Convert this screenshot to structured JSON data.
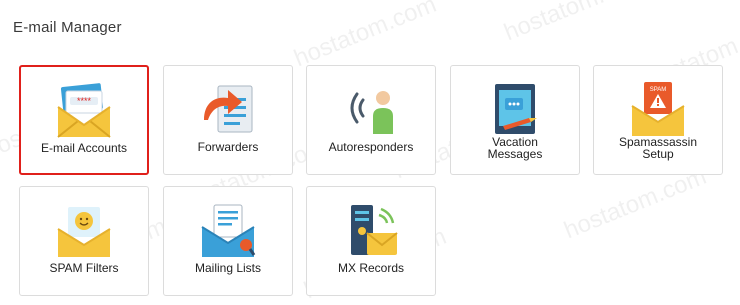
{
  "page": {
    "title": "E-mail Manager"
  },
  "tiles": [
    {
      "label": "E-mail Accounts",
      "icon": "envelope-password-icon"
    },
    {
      "label": "Forwarders",
      "icon": "forward-arrow-document-icon"
    },
    {
      "label": "Autoresponders",
      "icon": "person-broadcast-icon"
    },
    {
      "label_line1": "Vacation",
      "label_line2": "Messages",
      "icon": "vacation-message-icon"
    },
    {
      "label_line1": "Spamassassin",
      "label_line2": "Setup",
      "icon": "spam-warning-envelope-icon"
    },
    {
      "label": "SPAM Filters",
      "icon": "smiley-envelope-icon"
    },
    {
      "label": "Mailing Lists",
      "icon": "mailing-list-envelope-icon"
    },
    {
      "label": "MX Records",
      "icon": "server-envelope-icon"
    }
  ],
  "colors": {
    "selected_border": "#e0201b",
    "envelope_yellow": "#f5c53d",
    "accent_orange": "#e95a2a",
    "accent_blue": "#3aa0d8",
    "accent_green": "#7bc35a"
  },
  "watermark": {
    "text": "hostatom.com"
  }
}
